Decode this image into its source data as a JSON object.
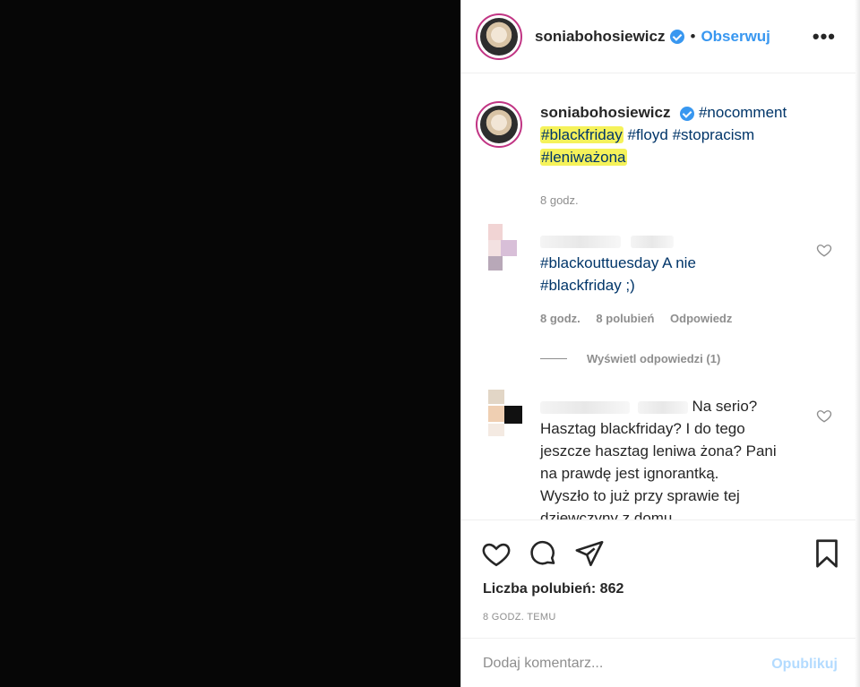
{
  "post": {
    "username": "soniabohosiewicz",
    "follow_label": "Obserwuj",
    "separator": "•",
    "more_label": "•••"
  },
  "caption": {
    "username": "soniabohosiewicz",
    "tags": [
      "#nocomment",
      "#blackfriday",
      "#floyd",
      "#stopracism",
      "#leniważona"
    ],
    "time": "8 godz."
  },
  "comments": [
    {
      "text_line1": "#blackouttuesday A nie",
      "text_line2": "#blackfriday ;)",
      "time": "8 godz.",
      "likes": "8 polubień",
      "reply": "Odpowiedz",
      "view_replies": "Wyświetl odpowiedzi (1)"
    },
    {
      "text_lead": "Na serio?",
      "text_lines": [
        "Hasztag blackfriday? I do tego",
        "jeszcze hasztag leniwa żona? Pani",
        "na prawdę jest ignorantką.",
        "Wyszło to już przy sprawie tej",
        "dziewczyny z domu"
      ]
    }
  ],
  "footer": {
    "likes_text": "Liczba polubień: 862",
    "time_ago": "8 GODZ. TEMU",
    "comment_placeholder": "Dodaj komentarz...",
    "publish_label": "Opublikuj"
  },
  "icons": [
    "heart-icon",
    "comment-icon",
    "share-icon",
    "bookmark-icon",
    "verified-badge-icon",
    "more-options-icon"
  ],
  "colors": {
    "link_blue": "#3897f0",
    "hashtag": "#003569",
    "highlight": "#f5f25a",
    "muted": "#8e8e8e"
  }
}
